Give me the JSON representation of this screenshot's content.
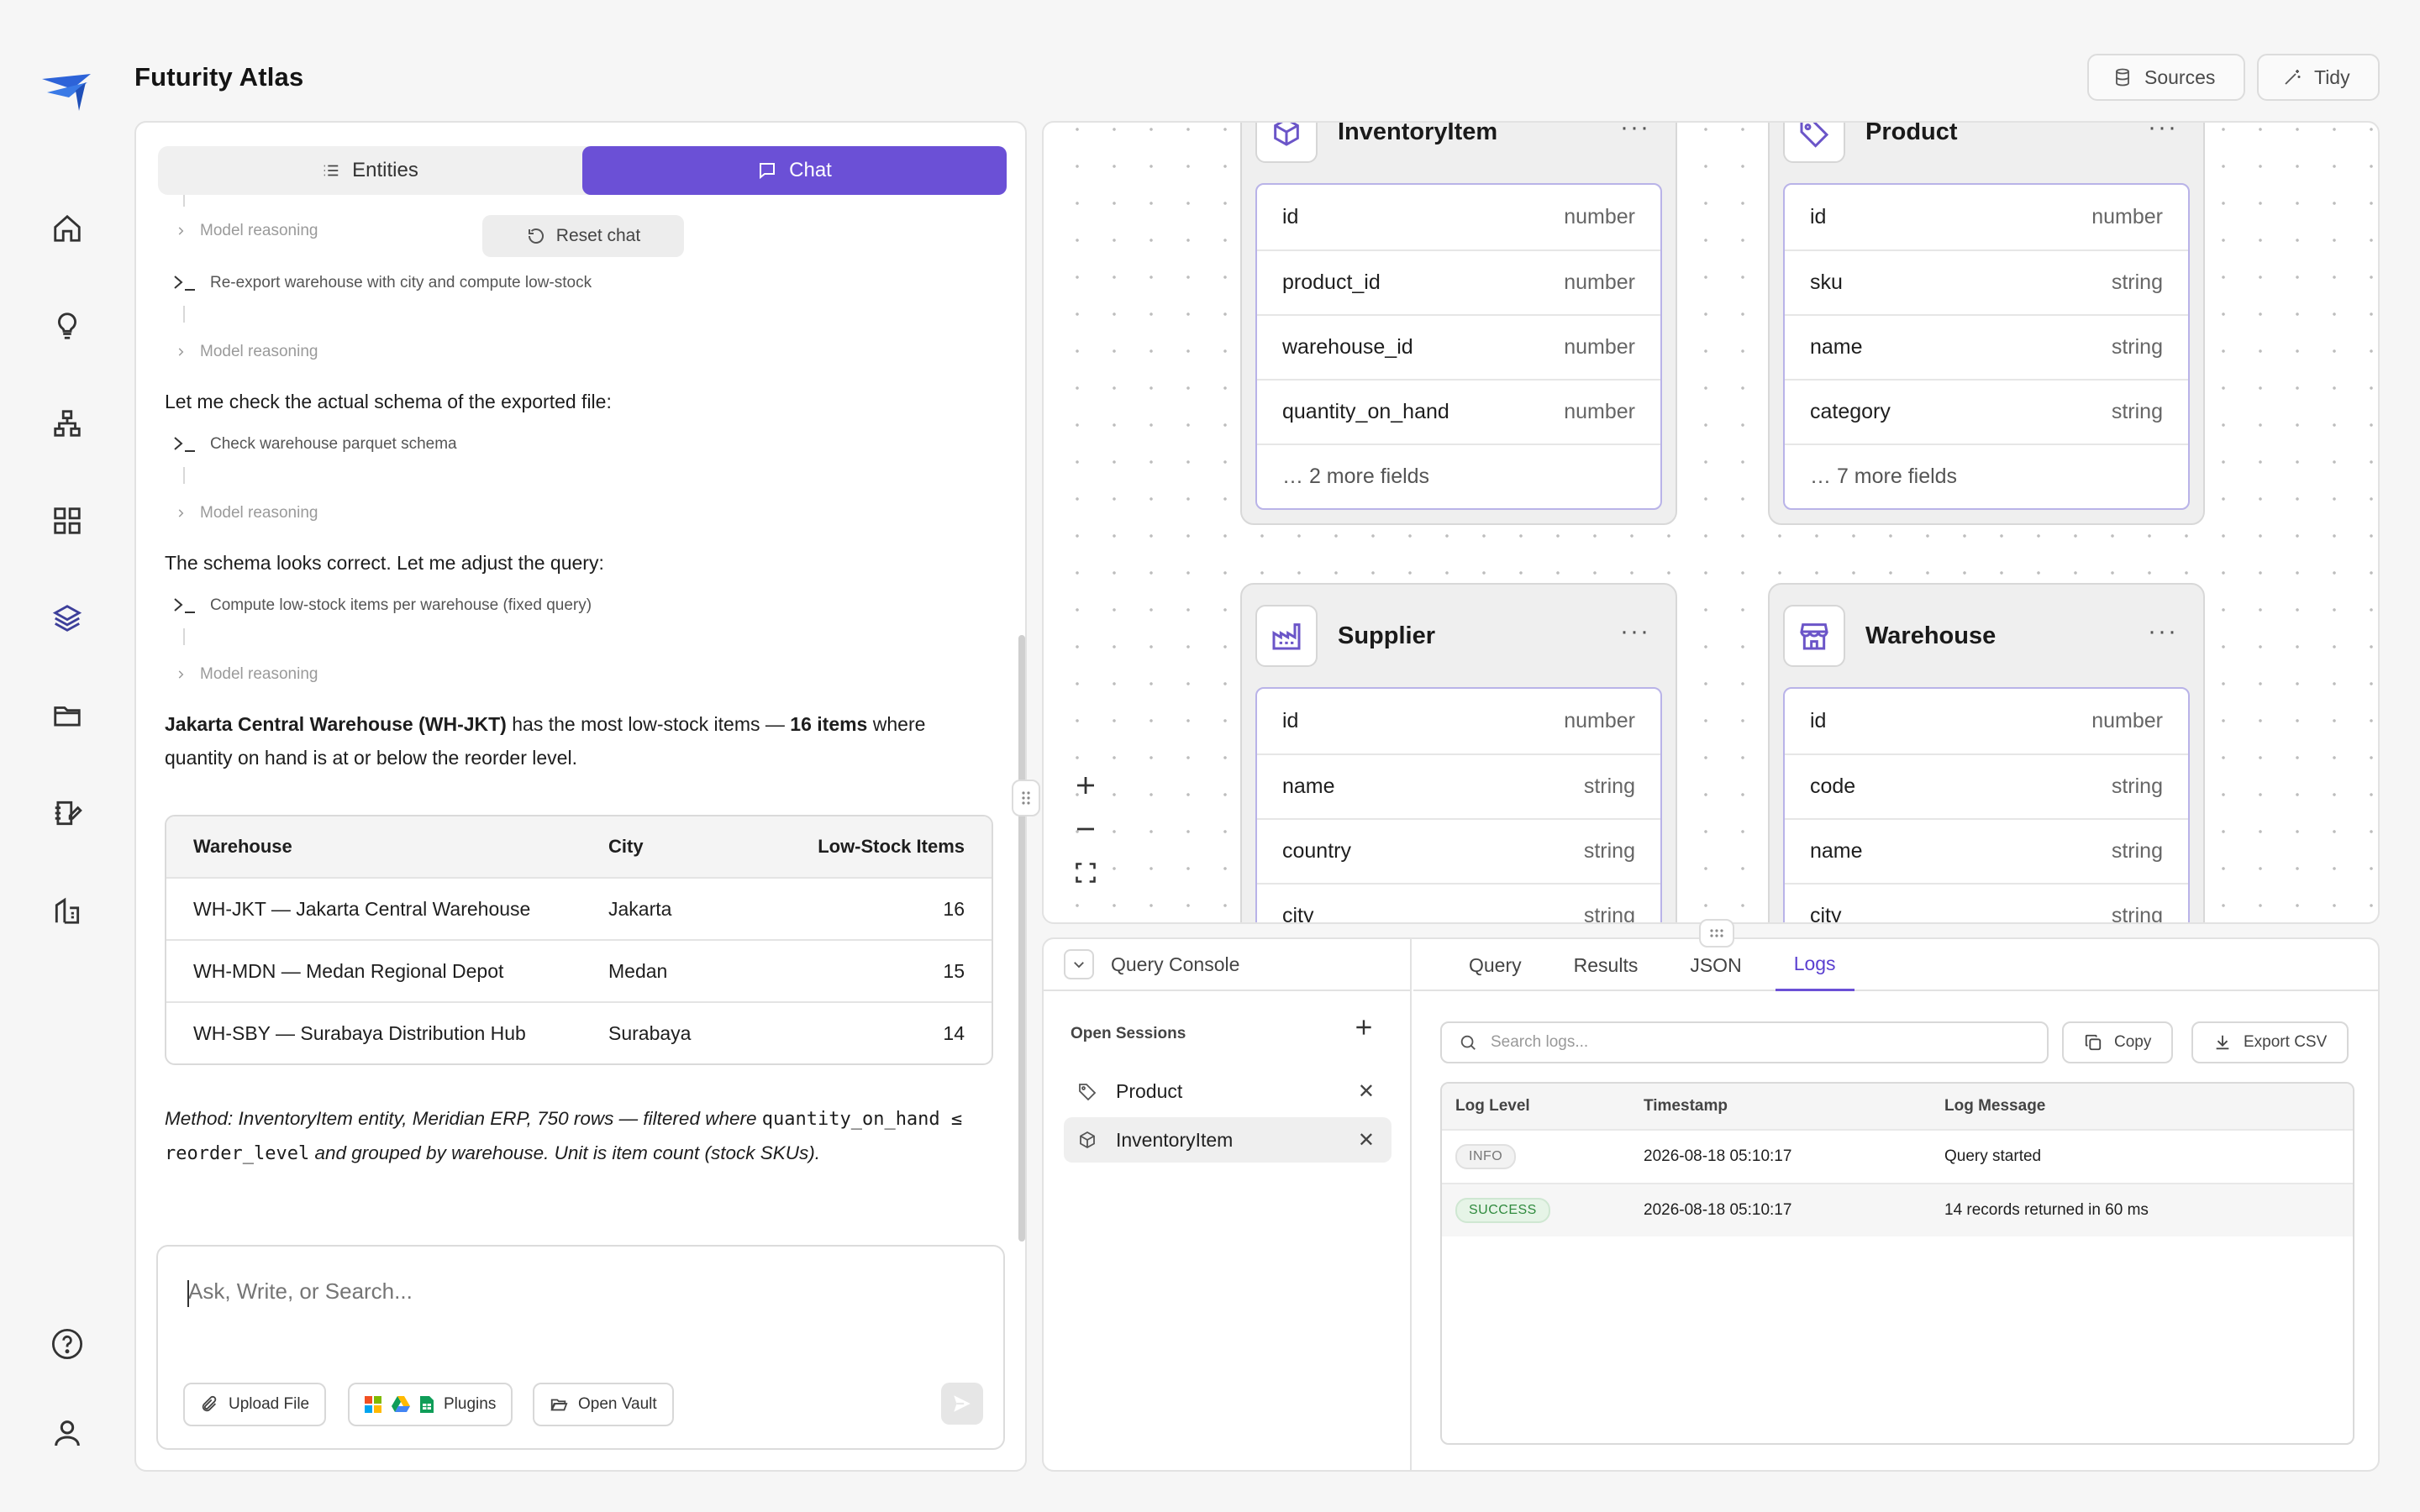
{
  "app": {
    "title": "Futurity Atlas"
  },
  "topbar": {
    "sources_label": "Sources",
    "tidy_label": "Tidy"
  },
  "rail": {
    "items": [
      {
        "name": "home-icon"
      },
      {
        "name": "lightbulb-icon"
      },
      {
        "name": "hierarchy-icon"
      },
      {
        "name": "grid-icon"
      },
      {
        "name": "layers-icon",
        "active": true
      },
      {
        "name": "folder-icon"
      },
      {
        "name": "edit-note-icon"
      },
      {
        "name": "building-icon"
      }
    ],
    "bottom": [
      {
        "name": "help-icon"
      },
      {
        "name": "user-icon"
      }
    ]
  },
  "left_panel": {
    "tabs": [
      {
        "label": "Entities"
      },
      {
        "label": "Chat",
        "active": true
      }
    ],
    "reset_label": "Reset chat",
    "chat": {
      "reasoning_label": "Model reasoning",
      "step1": "Re-export warehouse with city and compute low-stock",
      "msg1": "Let me check the actual schema of the exported file:",
      "step2": "Check warehouse parquet schema",
      "msg2": "The schema looks correct. Let me adjust the query:",
      "step3": "Compute low-stock items per warehouse (fixed query)",
      "answer_bold1": "Jakarta Central Warehouse (WH-JKT)",
      "answer_mid": " has the most low-stock items — ",
      "answer_bold2": "16 items",
      "answer_end": " where quantity on hand is at or below the reorder level."
    },
    "table": {
      "headers": [
        "Warehouse",
        "City",
        "Low-Stock Items"
      ],
      "rows": [
        [
          "WH-JKT — Jakarta Central Warehouse",
          "Jakarta",
          "16"
        ],
        [
          "WH-MDN — Medan Regional Depot",
          "Medan",
          "15"
        ],
        [
          "WH-SBY — Surabaya Distribution Hub",
          "Surabaya",
          "14"
        ]
      ]
    },
    "method": {
      "prefix": "Method: InventoryItem entity, Meridian ERP, 750 rows — filtered where ",
      "code": "quantity_on_hand ≤ reorder_level",
      "suffix": " and grouped by warehouse. Unit is item count (stock SKUs)."
    },
    "composer": {
      "placeholder": "Ask, Write, or Search...",
      "upload_label": "Upload File",
      "plugins_label": "Plugins",
      "vault_label": "Open Vault"
    }
  },
  "canvas": {
    "entities": [
      {
        "name": "InventoryItem",
        "icon": "box-icon",
        "fields": [
          [
            "id",
            "number"
          ],
          [
            "product_id",
            "number"
          ],
          [
            "warehouse_id",
            "number"
          ],
          [
            "quantity_on_hand",
            "number"
          ]
        ],
        "more": "… 2 more fields"
      },
      {
        "name": "Product",
        "icon": "tag-icon",
        "fields": [
          [
            "id",
            "number"
          ],
          [
            "sku",
            "string"
          ],
          [
            "name",
            "string"
          ],
          [
            "category",
            "string"
          ]
        ],
        "more": "… 7 more fields"
      },
      {
        "name": "Supplier",
        "icon": "factory-icon",
        "fields": [
          [
            "id",
            "number"
          ],
          [
            "name",
            "string"
          ],
          [
            "country",
            "string"
          ],
          [
            "city",
            "string"
          ]
        ]
      },
      {
        "name": "Warehouse",
        "icon": "store-icon",
        "fields": [
          [
            "id",
            "number"
          ],
          [
            "code",
            "string"
          ],
          [
            "name",
            "string"
          ],
          [
            "city",
            "string"
          ]
        ]
      }
    ]
  },
  "query_console": {
    "title": "Query Console",
    "open_sessions_label": "Open Sessions",
    "sessions": [
      {
        "label": "Product",
        "icon": "tag-icon"
      },
      {
        "label": "InventoryItem",
        "icon": "box-icon",
        "active": true
      }
    ],
    "tabs": [
      {
        "label": "Query"
      },
      {
        "label": "Results"
      },
      {
        "label": "JSON"
      },
      {
        "label": "Logs",
        "active": true
      }
    ],
    "search_placeholder": "Search logs...",
    "copy_label": "Copy",
    "export_label": "Export CSV",
    "log_headers": [
      "Log Level",
      "Timestamp",
      "Log Message"
    ],
    "logs": [
      {
        "level": "INFO",
        "timestamp": "2026-08-18 05:10:17",
        "message": "Query started"
      },
      {
        "level": "SUCCESS",
        "timestamp": "2026-08-18 05:10:17",
        "message": "14 records returned in 60 ms"
      }
    ]
  },
  "colors": {
    "accent": "#6b50d6",
    "brand": "#3d6fd9",
    "success": "#2f8a3d"
  }
}
